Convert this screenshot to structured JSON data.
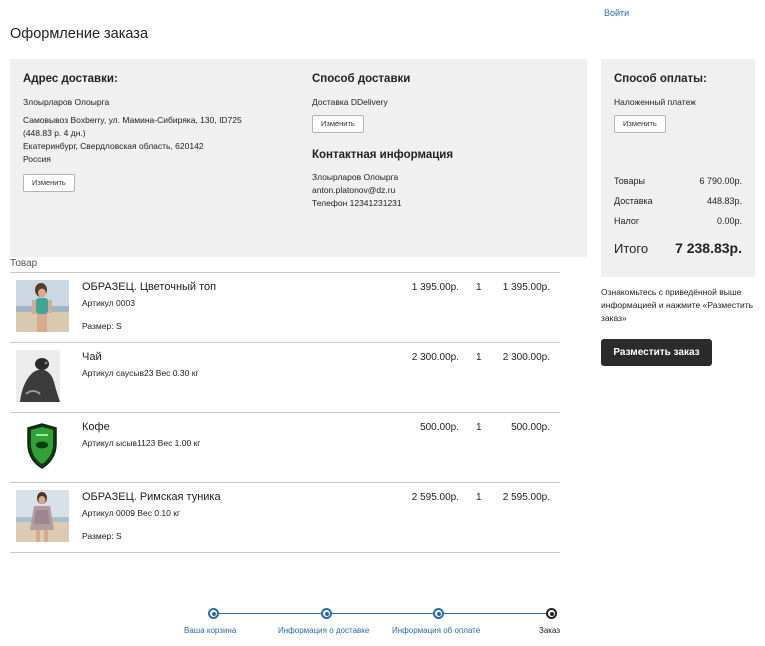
{
  "header": {
    "login_link": "Войти",
    "page_title": "Оформление заказа"
  },
  "address": {
    "title": "Адрес доставки:",
    "name": "Злоырларов Олоырга",
    "line1": "Самовывоз Boxberry, ул. Мамина-Сибиряка, 130, ID725",
    "line2": "(448.83 р. 4 дн.)",
    "line3": "Екатеринбург, Свердловская область, 620142",
    "line4": "Россия",
    "edit_label": "Изменить"
  },
  "delivery": {
    "title": "Способ доставки",
    "method": "Доставка DDelivery",
    "edit_label": "Изменить"
  },
  "contact": {
    "title": "Контактная информация",
    "name": "Злоырларов Олоырга",
    "email": "anton.platonov@dz.ru",
    "phone": "Телефон 12341231231"
  },
  "payment": {
    "title": "Способ оплаты:",
    "method": "Наложенный платеж",
    "edit_label": "Изменить"
  },
  "summary": {
    "goods_label": "Товары",
    "goods_value": "6 790.00р.",
    "shipping_label": "Доставка",
    "shipping_value": "448.83р.",
    "tax_label": "Налог",
    "tax_value": "0.00р.",
    "total_label": "Итого",
    "total_value": "7 238.83р."
  },
  "notice": "Ознакомьтесь с приведённой выше информацией и нажмите «Разместить заказ»",
  "place_order_label": "Разместить заказ",
  "items_header": "Товар",
  "items": [
    {
      "name": "ОБРАЗЕЦ. Цветочный топ",
      "sub": "Артикул 0003",
      "size": "Размер: S",
      "price": "1 395.00р.",
      "qty": "1",
      "total": "1 395.00р.",
      "thumb": "woman-beach-top"
    },
    {
      "name": "Чай",
      "sub": "Артикул саусыв23 Вес 0.30 кг",
      "size": "",
      "price": "2 300.00р.",
      "qty": "1",
      "total": "2 300.00р.",
      "thumb": "seal-bw"
    },
    {
      "name": "Кофе",
      "sub": "Артикул ысыв1123 Вес 1.00 кг",
      "size": "",
      "price": "500.00р.",
      "qty": "1",
      "total": "500.00р.",
      "thumb": "green-shield"
    },
    {
      "name": "ОБРАЗЕЦ. Римская туника",
      "sub": "Артикул 0009 Вес 0.10 кг",
      "size": "Размер: S",
      "price": "2 595.00р.",
      "qty": "1",
      "total": "2 595.00р.",
      "thumb": "woman-beach-tunic"
    }
  ],
  "progress": {
    "steps": [
      "Ваша корзина",
      "Информация о доставке",
      "Информация об оплате",
      "Заказ"
    ]
  },
  "colors": {
    "link": "#2a6db5",
    "panel_bg": "#f0f0f0",
    "primary_button": "#2b2b2b"
  }
}
